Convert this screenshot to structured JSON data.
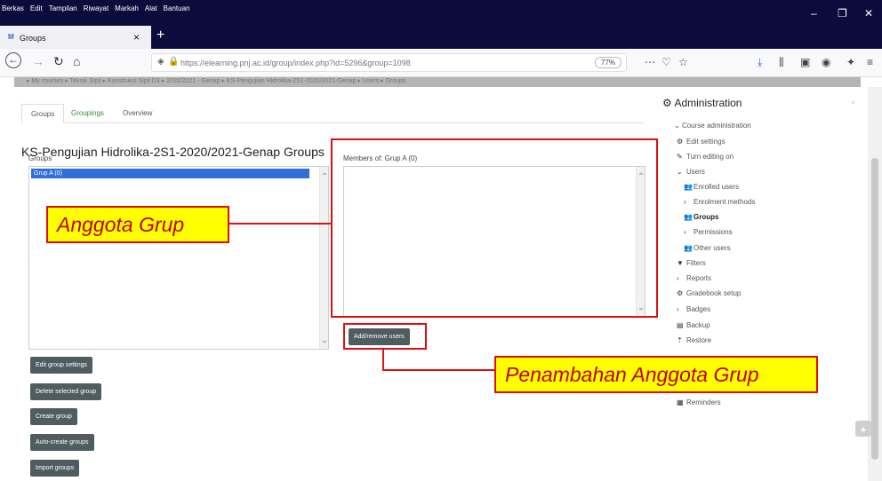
{
  "menubar": {
    "items": [
      "Berkas",
      "Edit",
      "Tampilan",
      "Riwayat",
      "Markah",
      "Alat",
      "Bantuan"
    ]
  },
  "browser": {
    "tab_title": "Groups",
    "url": "https://elearning.pnj.ac.id/group/index.php?id=5296&group=1098",
    "zoom": "77%"
  },
  "breadcrumb": "▸ My courses ▸ Teknik Sipil ▸ Konstruksi Sipil D3 ▸ 2020/2021 - Genap ▸ KS-Pengujian Hidrolika-2S1-2020/2021-Genap ▸ Users ▸ Groups",
  "tabs": [
    "Groups",
    "Groupings",
    "Overview"
  ],
  "page_title": "KS-Pengujian Hidrolika-2S1-2020/2021-Genap Groups",
  "groups_label": "Groups",
  "groups_list": [
    "Grup A (0)"
  ],
  "members_label": "Members of: Grup A (0)",
  "buttons": {
    "add_remove": "Add/remove users",
    "edit_group": "Edit group settings",
    "delete_group": "Delete selected group",
    "create_group": "Create group",
    "auto_create": "Auto-create groups",
    "import_groups": "Import groups"
  },
  "callouts": {
    "members": "Anggota Grup",
    "add_members": "Penambahan Anggota Grup"
  },
  "sidebar": {
    "title": "Administration",
    "course_admin": "Course administration",
    "items": [
      {
        "label": "Edit settings",
        "icon": "gear-icon",
        "glyph": "⚙"
      },
      {
        "label": "Turn editing on",
        "icon": "pencil-icon",
        "glyph": "✎"
      },
      {
        "label": "Users",
        "icon": "chevron-down-icon",
        "glyph": "⌄"
      },
      {
        "label": "Enrolled users",
        "icon": "users-icon",
        "glyph": "👥"
      },
      {
        "label": "Enrolment methods",
        "icon": "chevron-right-icon",
        "glyph": "›"
      },
      {
        "label": "Groups",
        "icon": "groups-icon",
        "glyph": "👥"
      },
      {
        "label": "Permissions",
        "icon": "chevron-right-icon",
        "glyph": "›"
      },
      {
        "label": "Other users",
        "icon": "users-icon",
        "glyph": "👥"
      },
      {
        "label": "Filters",
        "icon": "filter-icon",
        "glyph": "▼"
      },
      {
        "label": "Reports",
        "icon": "chevron-right-icon",
        "glyph": "›"
      },
      {
        "label": "Gradebook setup",
        "icon": "gear-icon",
        "glyph": "⚙"
      },
      {
        "label": "Badges",
        "icon": "chevron-right-icon",
        "glyph": "›"
      },
      {
        "label": "Backup",
        "icon": "backup-icon",
        "glyph": "▤"
      },
      {
        "label": "Restore",
        "icon": "restore-icon",
        "glyph": "⇡"
      },
      {
        "label": "Reminders",
        "icon": "calendar-icon",
        "glyph": "▦"
      }
    ]
  },
  "colors": {
    "titlebar": "#0c0c3c",
    "selection": "#2f6fd6",
    "button": "#4f5c60",
    "annotation_red": "#e01010",
    "annotation_fill": "#ffff00"
  }
}
